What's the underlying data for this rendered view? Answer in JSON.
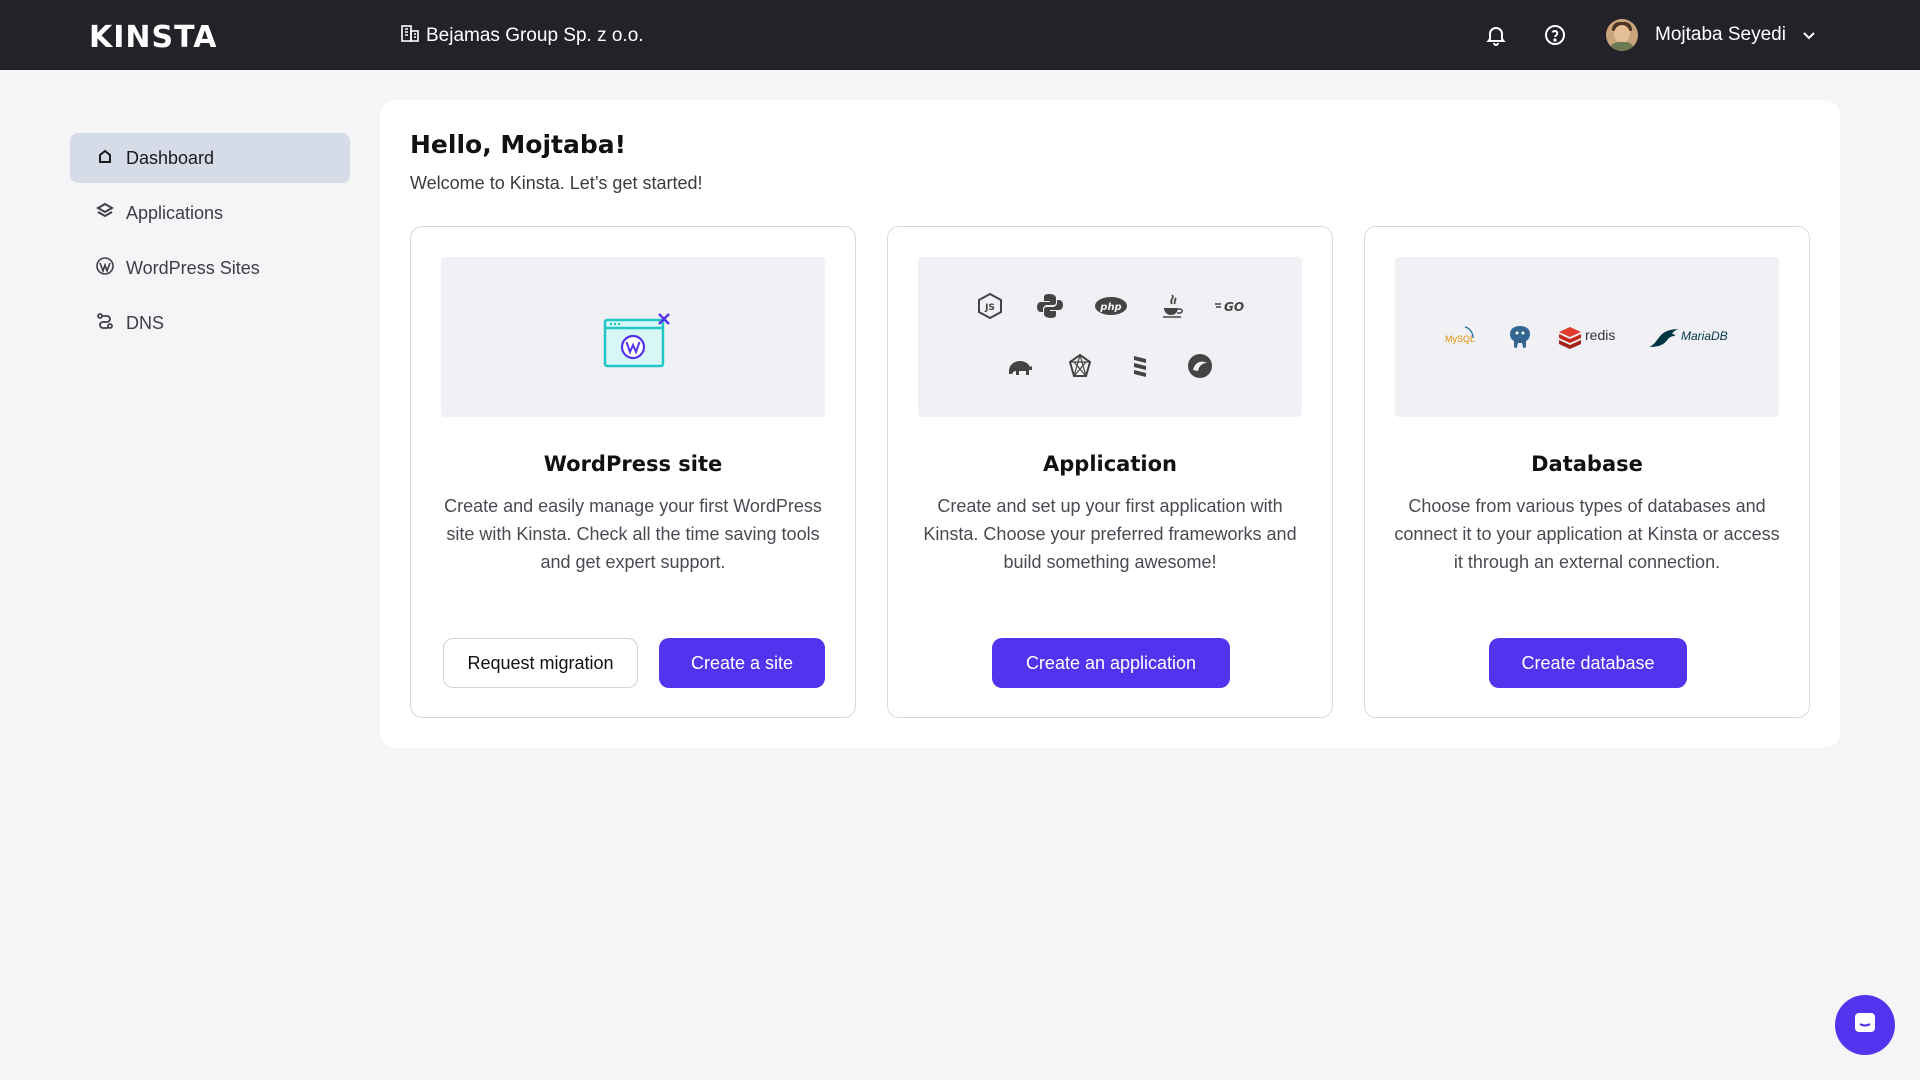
{
  "topbar": {
    "logo": "KINSTA",
    "company": "Bejamas Group Sp. z o.o.",
    "user_name": "Mojtaba Seyedi",
    "icons": [
      "building-icon",
      "bell-icon",
      "help-icon",
      "chevron-down-icon"
    ]
  },
  "sidebar": {
    "items": [
      {
        "label": "Dashboard",
        "icon": "home-icon",
        "active": true
      },
      {
        "label": "Applications",
        "icon": "layers-icon",
        "active": false
      },
      {
        "label": "WordPress Sites",
        "icon": "wordpress-icon",
        "active": false
      },
      {
        "label": "DNS",
        "icon": "dns-icon",
        "active": false
      }
    ]
  },
  "main": {
    "greeting": "Hello, Mojtaba!",
    "welcome": "Welcome to Kinsta. Let’s get started!",
    "cards": [
      {
        "title": "WordPress site",
        "description": "Create and easily manage your first WordPress site with Kinsta. Check all the time saving tools and get expert support.",
        "secondary_button": "Request migration",
        "primary_button": "Create a site"
      },
      {
        "title": "Application",
        "description": "Create and set up your first application with Kinsta. Choose your preferred frameworks and build something awesome!",
        "primary_button": "Create an application",
        "tech_icons": [
          "nodejs-icon",
          "python-icon",
          "php-icon",
          "java-icon",
          "go-icon",
          "laravel-icon",
          "ruby-icon",
          "scala-icon",
          "elixir-icon"
        ]
      },
      {
        "title": "Database",
        "description": "Choose from various types of databases and connect it to your application at Kinsta or access it through an external connection.",
        "primary_button": "Create database",
        "db_logos": {
          "mysql": "MySQL",
          "redis": "redis",
          "mariadb": "MariaDB"
        }
      }
    ]
  },
  "colors": {
    "accent": "#5333ed",
    "topbar": "#222228",
    "background": "#f5f5f7",
    "active_nav": "#d6dce7"
  }
}
